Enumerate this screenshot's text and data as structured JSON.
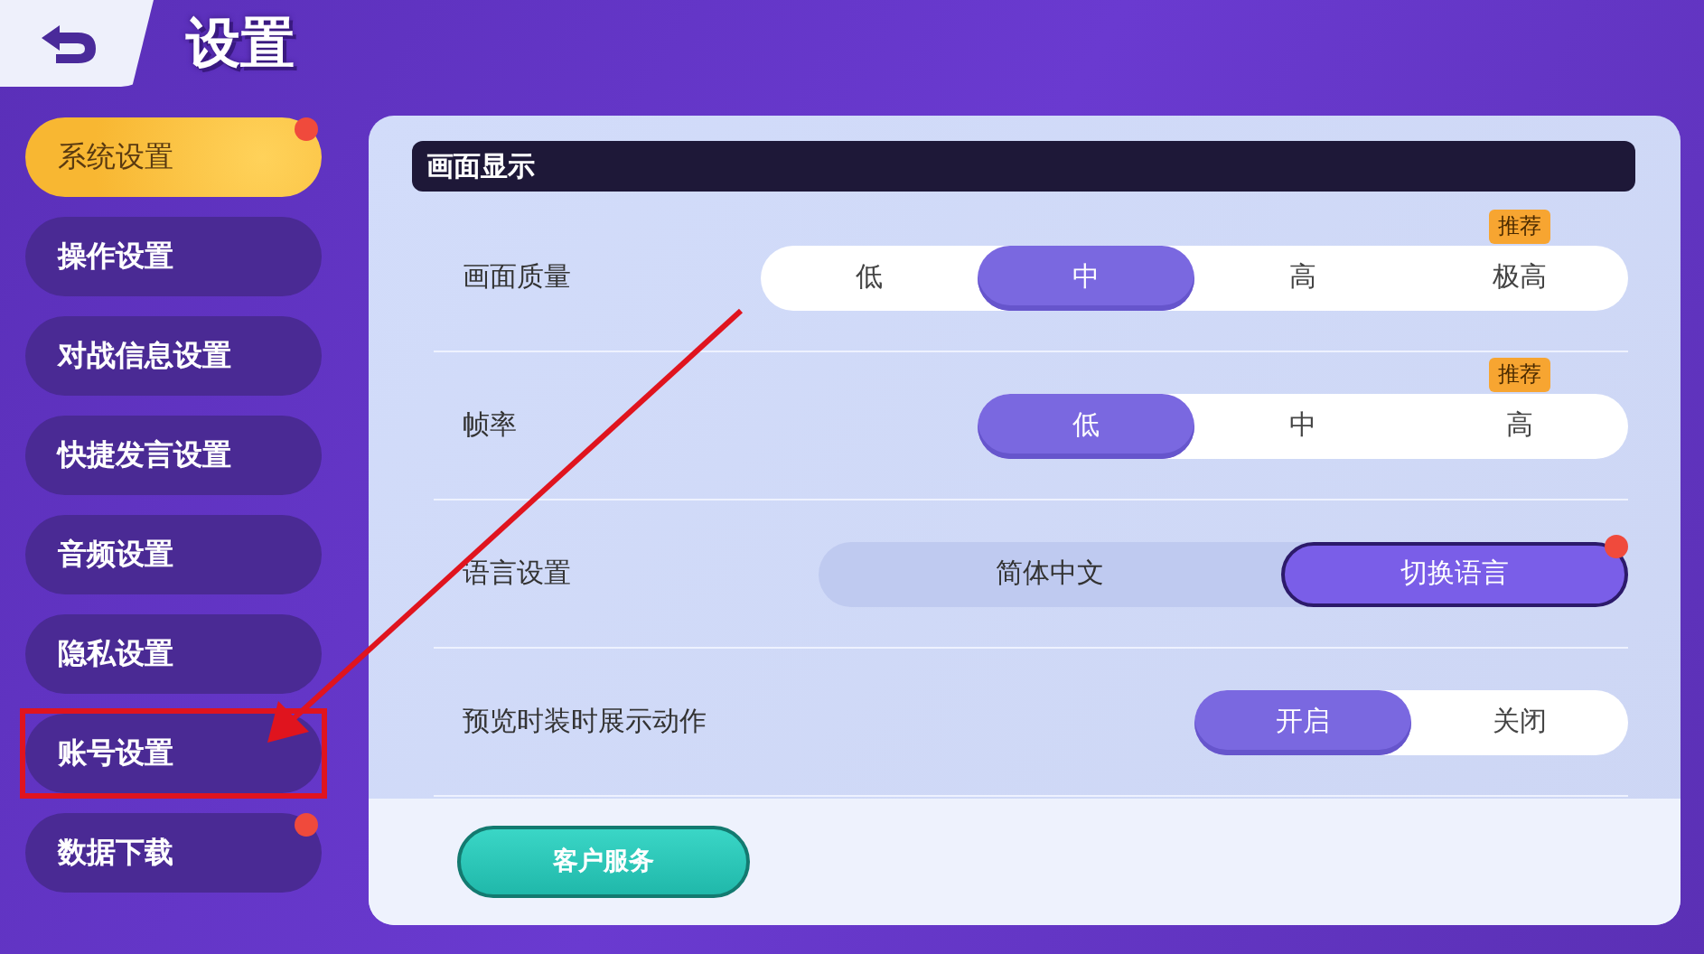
{
  "header": {
    "title": "设置"
  },
  "sidebar": {
    "items": [
      {
        "label": "系统设置",
        "selected": true,
        "badge": true,
        "highlighted": false
      },
      {
        "label": "操作设置",
        "selected": false,
        "badge": false,
        "highlighted": false
      },
      {
        "label": "对战信息设置",
        "selected": false,
        "badge": false,
        "highlighted": false
      },
      {
        "label": "快捷发言设置",
        "selected": false,
        "badge": false,
        "highlighted": false
      },
      {
        "label": "音频设置",
        "selected": false,
        "badge": false,
        "highlighted": false
      },
      {
        "label": "隐私设置",
        "selected": false,
        "badge": false,
        "highlighted": false
      },
      {
        "label": "账号设置",
        "selected": false,
        "badge": false,
        "highlighted": true
      },
      {
        "label": "数据下载",
        "selected": false,
        "badge": true,
        "highlighted": false
      }
    ]
  },
  "panel": {
    "section_title": "画面显示",
    "settings": [
      {
        "kind": "segmented",
        "label": "画面质量",
        "options": [
          {
            "label": "低",
            "selected": false
          },
          {
            "label": "中",
            "selected": true
          },
          {
            "label": "高",
            "selected": false
          },
          {
            "label": "极高",
            "selected": false,
            "tag": "推荐"
          }
        ]
      },
      {
        "kind": "segmented",
        "label": "帧率",
        "options": [
          {
            "label": "低",
            "selected": true
          },
          {
            "label": "中",
            "selected": false
          },
          {
            "label": "高",
            "selected": false,
            "tag": "推荐"
          }
        ]
      },
      {
        "kind": "language",
        "label": "语言设置",
        "value": "简体中文",
        "button": "切换语言",
        "badge": true
      },
      {
        "kind": "segmented",
        "label": "预览时装时展示动作",
        "options": [
          {
            "label": "开启",
            "selected": true
          },
          {
            "label": "关闭",
            "selected": false
          }
        ]
      }
    ],
    "footer_button": "客户服务"
  },
  "annotation": {
    "arrow": true
  }
}
